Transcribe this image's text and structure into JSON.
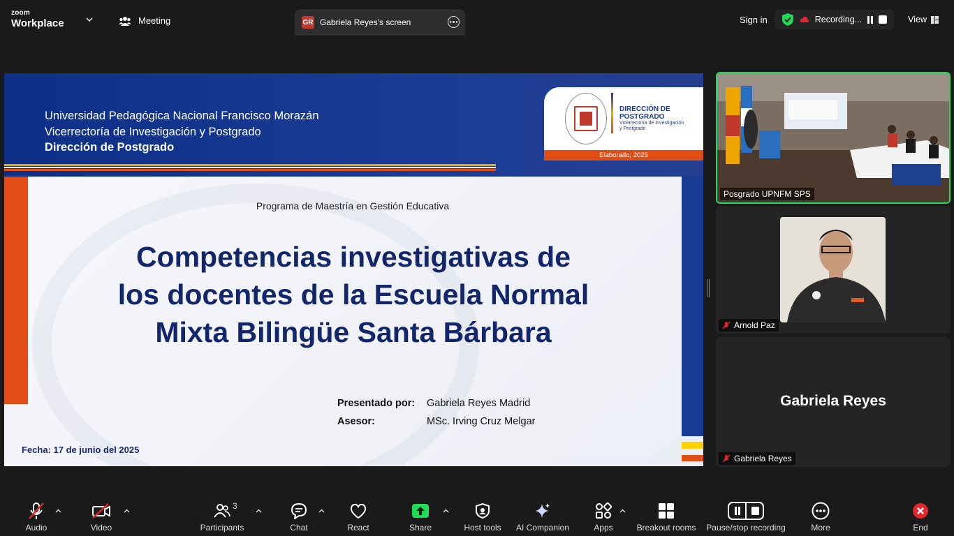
{
  "topbar": {
    "logo_line1": "zoom",
    "logo_line2": "Workplace",
    "meeting_label": "Meeting",
    "screen_tab": {
      "badge": "GR",
      "label": "Gabriela Reyes's screen"
    },
    "sign_in": "Sign in",
    "recording_label": "Recording...",
    "view_label": "View"
  },
  "slide": {
    "university_line1": "Universidad Pedagógica Nacional Francisco Morazán",
    "university_line2": "Vicerrectoría de Investigación y Postgrado",
    "university_line3": "Dirección de Postgrado",
    "card_title_1": "DIRECCIÓN DE",
    "card_title_2": "POSTGRADO",
    "card_sub_1": "Vicerrectoría de Investigación",
    "card_sub_2": "y Postgrado",
    "elaborado": "Elaborado, 2025",
    "programa": "Programa de Maestría en Gestión Educativa",
    "title_line1": "Competencias investigativas de",
    "title_line2": "los docentes de la Escuela Normal",
    "title_line3": "Mixta Bilingüe Santa Bárbara",
    "presentado_label": "Presentado por:",
    "presentado_value": "Gabriela Reyes Madrid",
    "asesor_label": "Asesor:",
    "asesor_value": "MSc. Irving Cruz Melgar",
    "fecha": "Fecha: 17 de junio del 2025"
  },
  "participants_panel": {
    "tile1_name": "Posgrado UPNFM SPS",
    "tile2_name": "Arnold Paz",
    "tile3_big": "Gabriela Reyes",
    "tile3_name": "Gabriela Reyes"
  },
  "toolbar": {
    "audio": "Audio",
    "video": "Video",
    "participants": "Participants",
    "participants_count": "3",
    "chat": "Chat",
    "react": "React",
    "share": "Share",
    "host_tools": "Host tools",
    "ai_companion": "AI Companion",
    "apps": "Apps",
    "breakout_rooms": "Breakout rooms",
    "pause_stop_recording": "Pause/stop recording",
    "more": "More",
    "end": "End"
  },
  "colors": {
    "active_speaker_border": "#23d959",
    "share_green": "#23d959",
    "end_red": "#e0282e",
    "slide_blue": "#1a3c96",
    "slide_orange": "#e04e16",
    "slide_yellow": "#ffd200"
  }
}
